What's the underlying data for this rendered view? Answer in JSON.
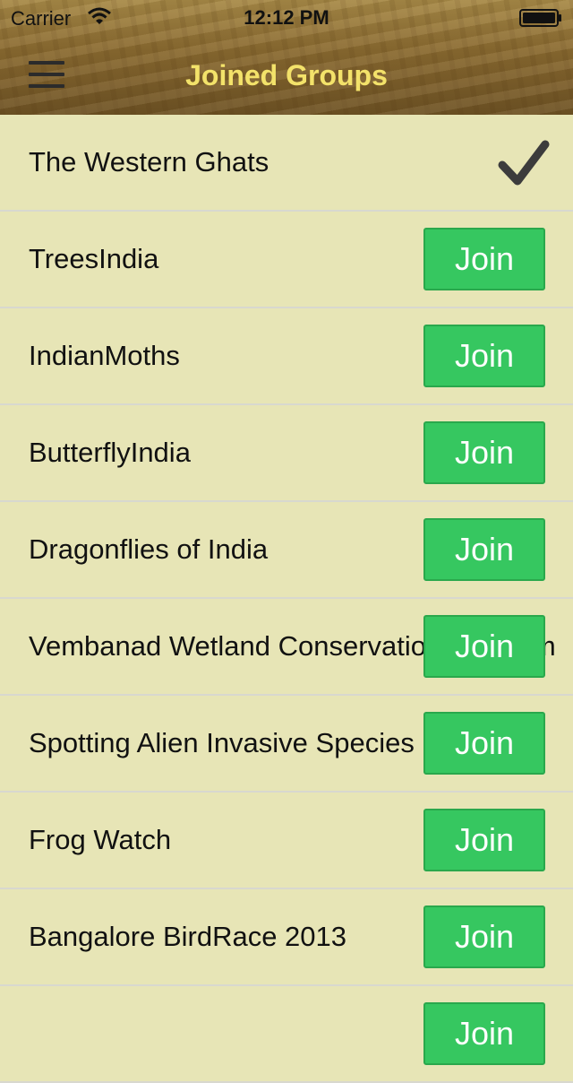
{
  "status_bar": {
    "carrier": "Carrier",
    "time": "12:12 PM"
  },
  "header": {
    "title": "Joined Groups",
    "menu_icon": "hamburger-menu-icon"
  },
  "colors": {
    "title": "#f3e26a",
    "background": "#e7e5b6",
    "join_button": "#36c760"
  },
  "groups": [
    {
      "name": "The Western Ghats",
      "joined": true
    },
    {
      "name": "TreesIndia",
      "joined": false,
      "action": "Join"
    },
    {
      "name": "IndianMoths",
      "joined": false,
      "action": "Join"
    },
    {
      "name": "ButterflyIndia",
      "joined": false,
      "action": "Join"
    },
    {
      "name": "Dragonflies of India",
      "joined": false,
      "action": "Join"
    },
    {
      "name": "Vembanad Wetland Conservation Program",
      "joined": false,
      "action": "Join"
    },
    {
      "name": "Spotting Alien Invasive Species",
      "joined": false,
      "action": "Join"
    },
    {
      "name": "Frog Watch",
      "joined": false,
      "action": "Join"
    },
    {
      "name": "Bangalore BirdRace 2013",
      "joined": false,
      "action": "Join"
    },
    {
      "name": "",
      "joined": false,
      "action": "Join"
    }
  ]
}
